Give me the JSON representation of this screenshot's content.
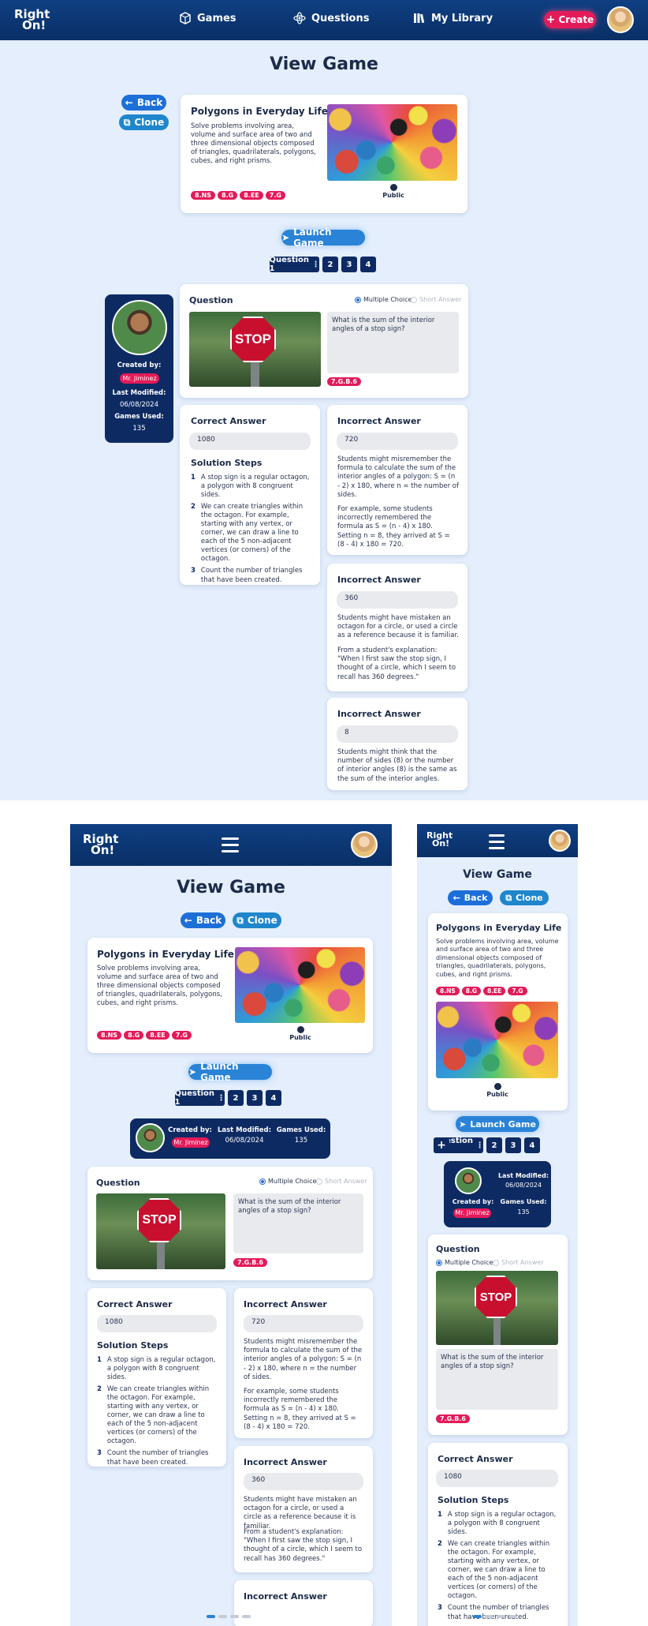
{
  "brand": {
    "logo_line1": "Right",
    "logo_line2": "On!"
  },
  "nav": {
    "games": "Games",
    "questions": "Questions",
    "library": "My Library",
    "create": "Create"
  },
  "page": {
    "title": "View Game"
  },
  "actions": {
    "back": "Back",
    "clone": "Clone",
    "launch": "Launch Game"
  },
  "game": {
    "title": "Polygons in Everyday Life",
    "description": "Solve problems involving area, volume and surface area of two and three dimensional objects composed of triangles, quadrilaterals, polygons, cubes, and right prisms.",
    "tags": [
      "8.NS",
      "8.G",
      "8.EE",
      "7.G"
    ],
    "visibility": "Public"
  },
  "question_nav": {
    "current": "Question 1",
    "items": [
      "2",
      "3",
      "4"
    ],
    "add": "+"
  },
  "creator": {
    "created_by_label": "Created by:",
    "name": "Mr. Jiminez",
    "last_modified_label": "Last Modified:",
    "last_modified": "06/08/2024",
    "games_used_label": "Games Used:",
    "games_used": "135"
  },
  "question": {
    "heading": "Question",
    "type_mc": "Multiple Choice",
    "type_sa": "Short Answer",
    "text": "What is the sum of the interior angles of a stop sign?",
    "image_text": "STOP",
    "tag": "7.G.B.6"
  },
  "correct": {
    "heading": "Correct Answer",
    "value": "1080",
    "steps_heading": "Solution Steps",
    "steps": [
      {
        "n": "1",
        "text": "A stop sign is a regular octagon, a polygon with 8 congruent sides."
      },
      {
        "n": "2",
        "text": "We can create triangles within the octagon. For example, starting with any vertex, or corner, we can draw a line to each of the 5 non-adjacent vertices (or corners) of the octagon."
      },
      {
        "n": "3",
        "text": "Count the number of triangles that have been created."
      }
    ]
  },
  "incorrect": [
    {
      "heading": "Incorrect Answer",
      "value": "720",
      "p1": "Students might misremember the formula to calculate the sum of the interior angles of a polygon: S = (n - 2) x 180, where n = the number of sides.",
      "p2": "For example, some students incorrectly remembered the formula as S = (n - 4) x 180. Setting n = 8, they arrived at S = (8 - 4) x 180 = 720."
    },
    {
      "heading": "Incorrect Answer",
      "value": "360",
      "p1": "Students might have mistaken an octagon for a circle, or used a circle as a reference because it is familiar.",
      "p2": "From a student's explanation: \"When I first saw the stop sign, I thought of a circle, which I seem to recall has 360 degrees.\""
    },
    {
      "heading": "Incorrect Answer",
      "value": "8",
      "p1": "Students might think that the number of sides (8) or the number of interior angles (8) is the same as the sum of the interior angles.",
      "p2": ""
    }
  ],
  "colors": {
    "navy": "#0d2a63",
    "header": "#0f3f82",
    "accent_pink": "#e31b59",
    "accent_blue": "#2a83d6",
    "bg": "#e4eefc"
  },
  "pager": {
    "active_index": 0,
    "count": 4
  }
}
